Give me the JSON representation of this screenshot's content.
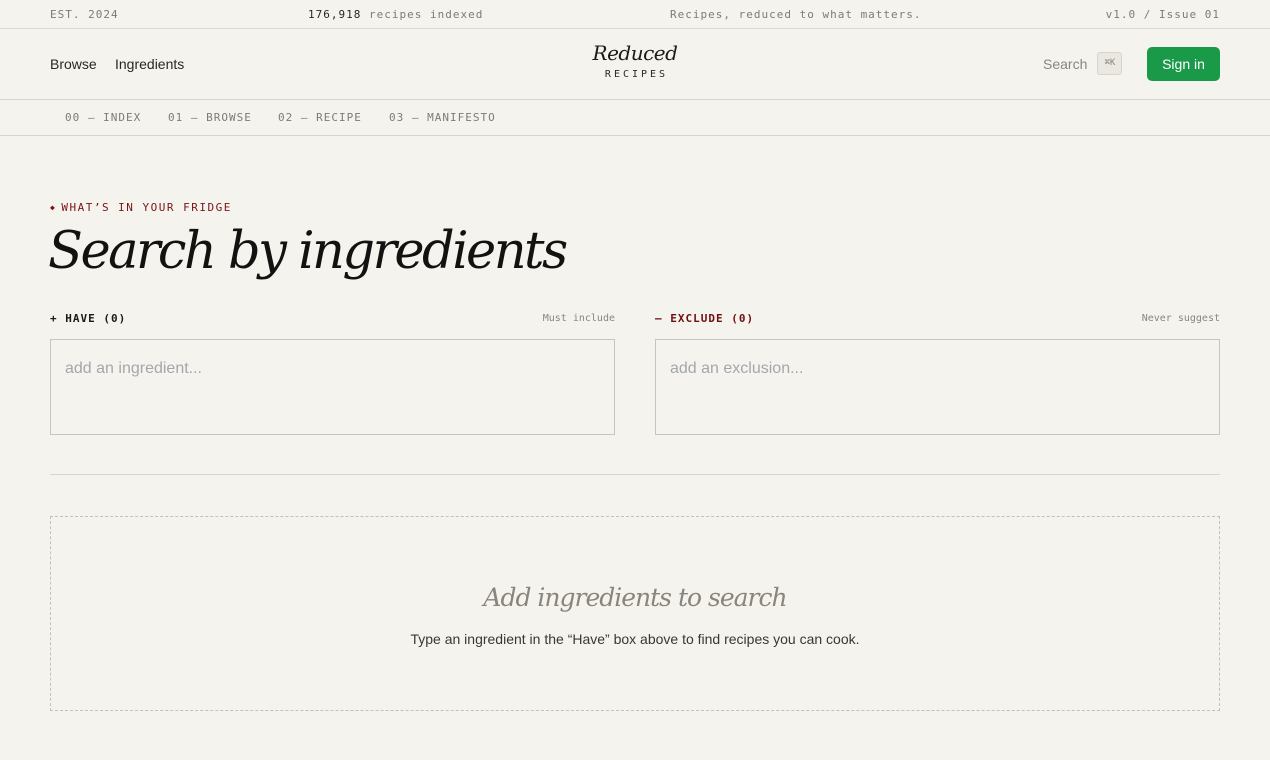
{
  "topstrip": {
    "est": "EST. 2024",
    "recipe_count": "176,918",
    "recipe_count_suffix": " recipes indexed",
    "tagline": "Recipes, reduced to what matters.",
    "version": "v1.0 / Issue 01"
  },
  "nav": {
    "browse": "Browse",
    "ingredients": "Ingredients",
    "logo_word": "Reduced",
    "logo_sub": "RECIPES",
    "search_label": "Search",
    "search_shortcut": "⌘K",
    "signin": "Sign in"
  },
  "subnav": {
    "items": [
      {
        "label": "00 — INDEX"
      },
      {
        "label": "01 — BROWSE"
      },
      {
        "label": "02 — RECIPE"
      },
      {
        "label": "03 — MANIFESTO"
      }
    ]
  },
  "hero": {
    "eyebrow": "WHAT’S IN YOUR FRIDGE",
    "title": "Search by ingredients"
  },
  "have": {
    "label": "+ HAVE (0)",
    "hint": "Must include",
    "placeholder": "add an ingredient..."
  },
  "exclude": {
    "label": "— EXCLUDE (0)",
    "hint": "Never suggest",
    "placeholder": "add an exclusion..."
  },
  "empty_state": {
    "title": "Add ingredients to search",
    "text": "Type an ingredient in the “Have” box above to find recipes you can cook."
  },
  "colors": {
    "background": "#f5f3ee",
    "accent_green": "#1a9a49",
    "accent_red": "#7a1414"
  }
}
